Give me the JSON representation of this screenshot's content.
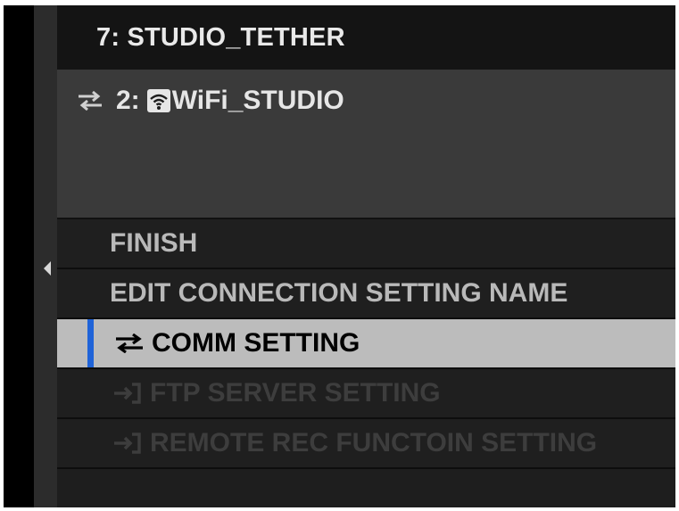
{
  "header": {
    "title": "7: STUDIO_TETHER"
  },
  "info": {
    "connection_prefix": "2:",
    "network_name": "WiFi_STUDIO"
  },
  "menu": {
    "items": [
      {
        "label": "FINISH",
        "state": "normal"
      },
      {
        "label": "EDIT CONNECTION SETTING NAME",
        "state": "normal"
      },
      {
        "label": "COMM SETTING",
        "state": "selected",
        "icon": "swap-arrows-icon"
      },
      {
        "label": "FTP SERVER SETTING",
        "state": "disabled",
        "icon": "login-arrow-icon"
      },
      {
        "label": "REMOTE REC FUNCTOIN SETTING",
        "state": "disabled",
        "icon": "login-arrow-icon"
      }
    ]
  },
  "colors": {
    "selection_accent": "#1f63d8",
    "selected_background": "#bcbcbc",
    "panel_background": "#1e1e1e"
  }
}
